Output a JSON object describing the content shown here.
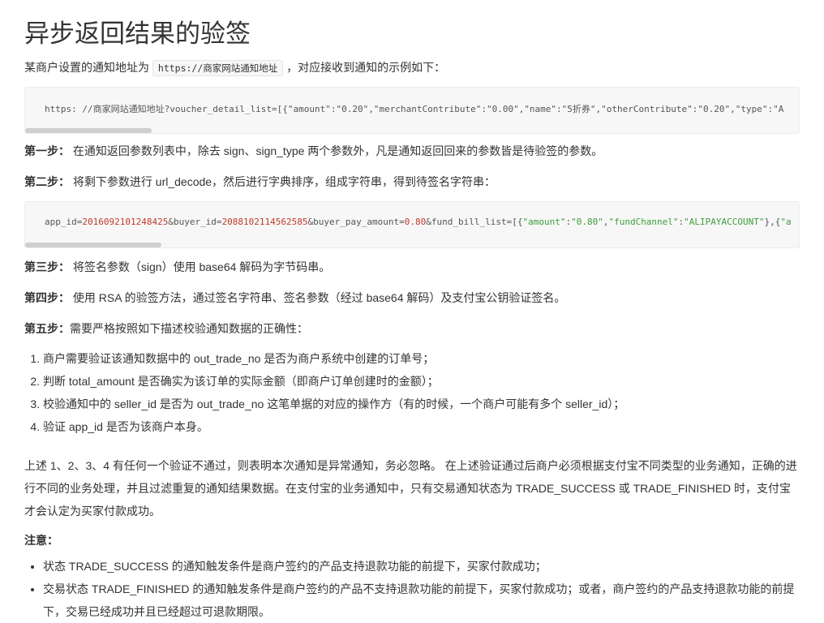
{
  "title": "异步返回结果的验签",
  "intro": {
    "before": "某商户设置的通知地址为",
    "code": "https://商家网站通知地址",
    "after": "，对应接收到通知的示例如下："
  },
  "code_sample_1": {
    "line": "https: //商家网站通知地址?voucher_detail_list=[{\"amount\":\"0.20\",\"merchantContribute\":\"0.00\",\"name\":\"5折券\",\"otherContribute\":\"0.20\",\"type\":\"A"
  },
  "steps": [
    {
      "label": "第一步：",
      "text": " 在通知返回参数列表中，除去 sign、sign_type 两个参数外，凡是通知返回回来的参数皆是待验签的参数。"
    },
    {
      "label": "第二步：",
      "text": " 将剩下参数进行 url_decode，然后进行字典排序，组成字符串，得到待签名字符串："
    }
  ],
  "code_sample_2": {
    "part1": "app_id=",
    "v1": "2016092101248425",
    "part2": "&buyer_id=",
    "v2": "2088102114562585",
    "part3": "&buyer_pay_amount=",
    "v3": "0.80",
    "part4": "&fund_bill_list=[{",
    "v4": "\"amount\"",
    "part5": ":",
    "v5": "\"0.80\"",
    "part6": ",",
    "v6": "\"fundChannel\"",
    "part7": ":",
    "v7": "\"ALIPAYACCOUNT\"",
    "part8": "},{",
    "v8": "\"a"
  },
  "steps_after": [
    {
      "label": "第三步：",
      "text": " 将签名参数（sign）使用 base64 解码为字节码串。"
    },
    {
      "label": "第四步：",
      "text": " 使用 RSA 的验签方法，通过签名字符串、签名参数（经过 base64 解码）及支付宝公钥验证签名。"
    },
    {
      "label": "第五步：",
      "text": "需要严格按照如下描述校验通知数据的正确性："
    }
  ],
  "checks": [
    "商户需要验证该通知数据中的 out_trade_no 是否为商户系统中创建的订单号；",
    "判断 total_amount 是否确实为该订单的实际金额（即商户订单创建时的金额）；",
    "校验通知中的 seller_id 是否为 out_trade_no 这笔单据的对应的操作方（有的时候，一个商户可能有多个 seller_id）；",
    "验证 app_id 是否为该商户本身。"
  ],
  "summary": "上述 1、2、3、4 有任何一个验证不通过，则表明本次通知是异常通知，务必忽略。 在上述验证通过后商户必须根据支付宝不同类型的业务通知，正确的进行不同的业务处理，并且过滤重复的通知结果数据。在支付宝的业务通知中，只有交易通知状态为 TRADE_SUCCESS 或 TRADE_FINISHED 时，支付宝才会认定为买家付款成功。",
  "note_label": "注意：",
  "notes": [
    "状态 TRADE_SUCCESS 的通知触发条件是商户签约的产品支持退款功能的前提下，买家付款成功；",
    "交易状态 TRADE_FINISHED 的通知触发条件是商户签约的产品不支持退款功能的前提下，买家付款成功；或者，商户签约的产品支持退款功能的前提下，交易已经成功并且已经超过可退款期限。"
  ]
}
